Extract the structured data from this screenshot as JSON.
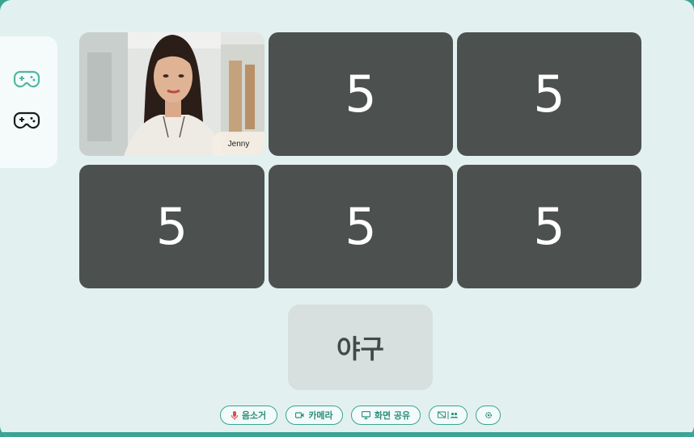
{
  "sidebar": {
    "items": [
      {
        "icon": "gamepad-icon",
        "state": "active",
        "color": "#52b5a3"
      },
      {
        "icon": "gamepad-icon",
        "state": "default",
        "color": "#1c1c1c"
      }
    ]
  },
  "grid": {
    "video": {
      "name": "Jenny"
    },
    "tiles": [
      "5",
      "5",
      "5",
      "5",
      "5"
    ]
  },
  "word_card": {
    "text": "야구"
  },
  "controls": {
    "mute": {
      "label": "음소거",
      "icon": "mic-icon",
      "icon_color": "#e14b4b"
    },
    "camera": {
      "label": "카메라",
      "icon": "video-camera-icon"
    },
    "share": {
      "label": "화면 공유",
      "icon": "monitor-icon"
    },
    "layout": {
      "icon": "grid-participants-icon"
    },
    "settings": {
      "icon": "gear-icon"
    }
  },
  "colors": {
    "accent": "#3aa393",
    "tile": "#4c5150",
    "background": "#e2f1ef"
  }
}
